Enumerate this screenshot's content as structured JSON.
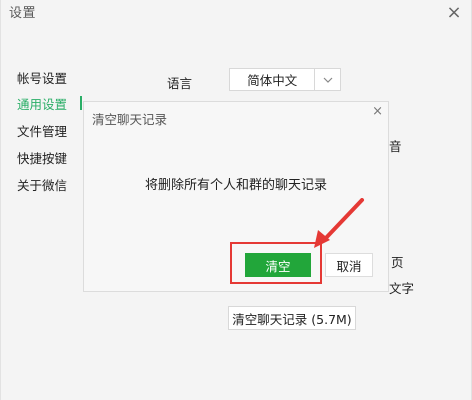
{
  "window": {
    "title": "设置",
    "close_glyph": "×"
  },
  "sidebar": {
    "items": [
      {
        "label": "帐号设置"
      },
      {
        "label": "通用设置"
      },
      {
        "label": "文件管理"
      },
      {
        "label": "快捷按键"
      },
      {
        "label": "关于微信"
      }
    ],
    "active_index": 1
  },
  "content": {
    "language_label": "语言",
    "language_value": "简体中文",
    "partial_sound": "音",
    "partial_page": "页",
    "partial_text": "文字",
    "clear_history_button": "清空聊天记录 (5.7M)"
  },
  "dialog": {
    "title": "清空聊天记录",
    "close_glyph": "×",
    "message": "将删除所有个人和群的聊天记录",
    "confirm": "清空",
    "cancel": "取消"
  },
  "colors": {
    "accent": "#2aae67",
    "confirm_button": "#22a63a",
    "annotation": "#e53935"
  }
}
